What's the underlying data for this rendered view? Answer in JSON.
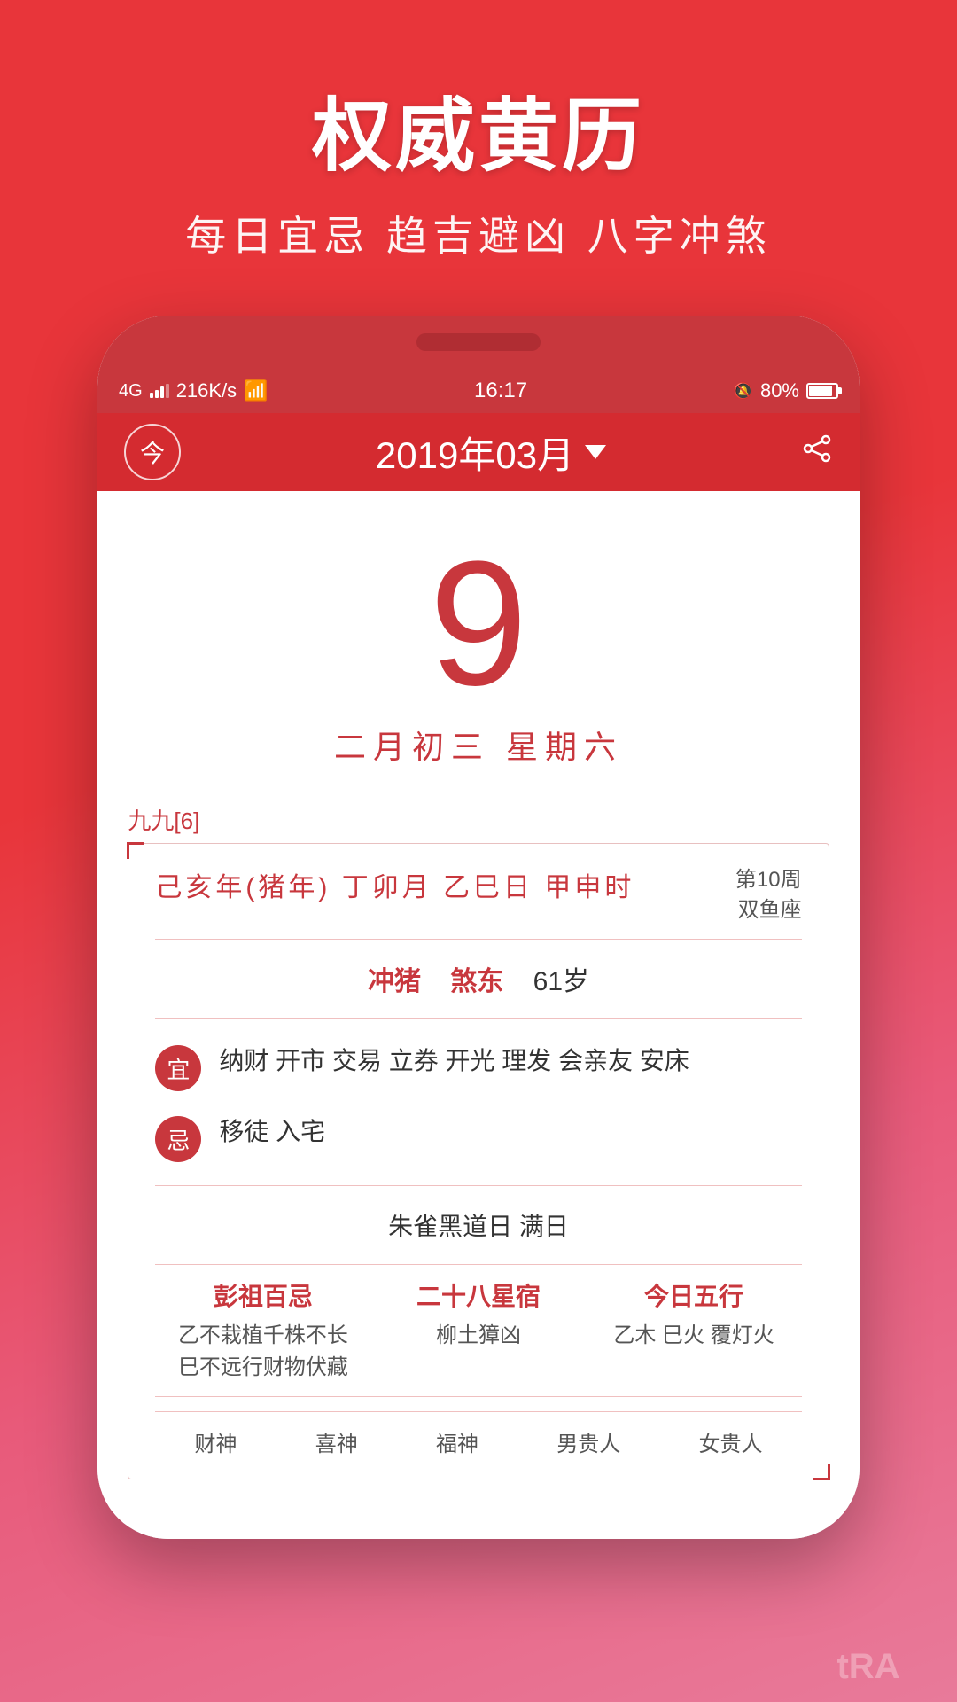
{
  "app": {
    "title": "权威黄历",
    "subtitle": "每日宜忌 趋吉避凶 八字冲煞"
  },
  "status_bar": {
    "signal": "4G",
    "speed": "216K/s",
    "wifi": "WiFi",
    "time": "16:17",
    "alarm": "🔕",
    "battery": "80%"
  },
  "nav": {
    "today_label": "今",
    "month_title": "2019年03月",
    "share_label": "分享"
  },
  "date": {
    "day": "9",
    "lunar": "二月初三  星期六"
  },
  "jiujiu": {
    "label": "九九[6]"
  },
  "ganzhi": {
    "main": "己亥年(猪年) 丁卯月  乙巳日  甲申时",
    "week": "第10周",
    "zodiac": "双鱼座"
  },
  "chong": {
    "label1": "冲猪",
    "label2": "煞东",
    "age": "61岁"
  },
  "yi": {
    "badge": "宜",
    "content": "纳财 开市 交易 立券 开光 理发 会亲友 安床"
  },
  "ji": {
    "badge": "忌",
    "content": "移徒 入宅"
  },
  "heisha": {
    "text": "朱雀黑道日  满日"
  },
  "three_cols": {
    "col1": {
      "title": "彭祖百忌",
      "line1": "乙不栽植千株不长",
      "line2": "巳不远行财物伏藏"
    },
    "col2": {
      "title": "二十八星宿",
      "content": "柳土獐凶"
    },
    "col3": {
      "title": "今日五行",
      "content": "乙木 巳火 覆灯火"
    }
  },
  "bottom_row": {
    "items": [
      "财神",
      "喜神",
      "福神",
      "男贵人",
      "女贵人"
    ]
  },
  "watermark": {
    "text": "tRA"
  }
}
